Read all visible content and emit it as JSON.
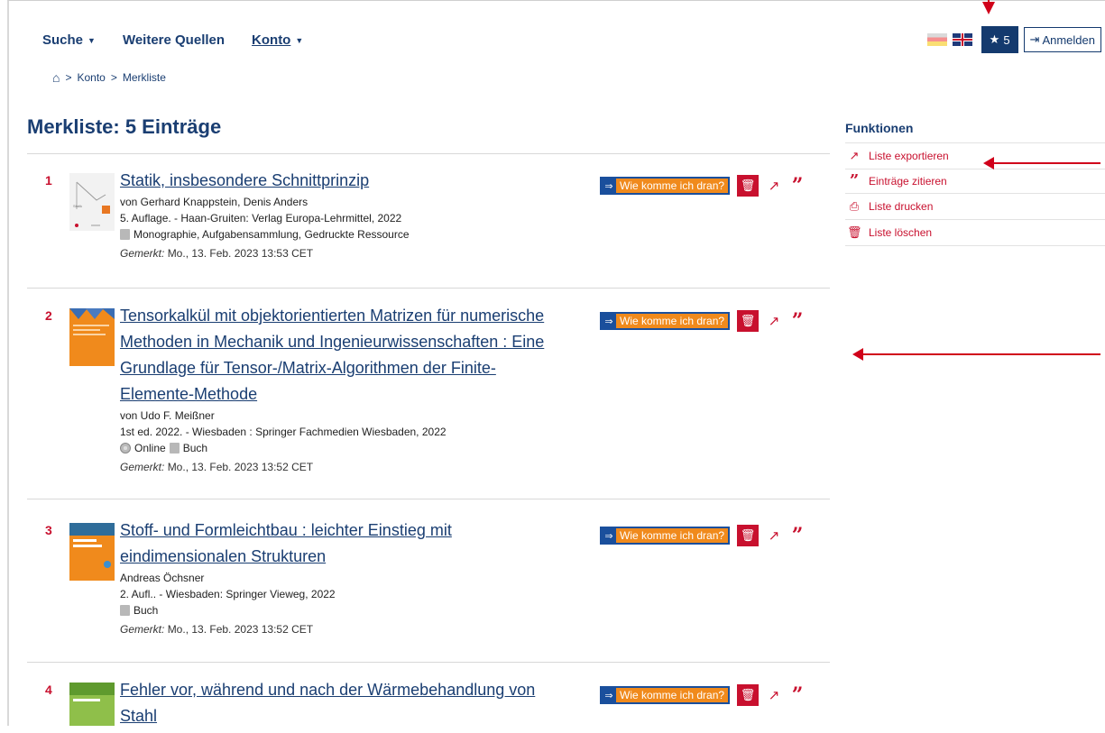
{
  "nav": {
    "items": [
      {
        "label": "Suche",
        "has_caret": true
      },
      {
        "label": "Weitere Quellen",
        "has_caret": false
      },
      {
        "label": "Konto",
        "has_caret": true
      }
    ]
  },
  "topright": {
    "bookmark_count": "5",
    "login_label": "Anmelden"
  },
  "breadcrumb": {
    "items": [
      "Konto",
      "Merkliste"
    ],
    "separator": ">"
  },
  "page_title": "Merkliste: 5 Einträge",
  "actions": {
    "wie_label": "Wie komme ich dran?"
  },
  "entries": [
    {
      "number": "1",
      "title_lines": [
        "Statik, insbesondere Schnittprinzip"
      ],
      "authors": "von Gerhard Knappstein, Denis Anders",
      "edition": "5. Auflage. - Haan-Gruiten: Verlag Europa-Lehrmittel, 2022",
      "media": [
        "Monographie, Aufgabensammlung, Gedruckte Ressource"
      ],
      "saved_prefix": "Gemerkt:",
      "saved_date": "Mo., 13. Feb. 2023 13:53 CET"
    },
    {
      "number": "2",
      "title_lines": [
        "Tensorkalkül mit objektorientierten Matrizen für numerische",
        "Methoden in Mechanik und Ingenieurwissenschaften : Eine",
        "Grundlage für Tensor-/Matrix-Algorithmen der Finite-",
        "Elemente-Methode"
      ],
      "authors": "von Udo F. Meißner",
      "edition": "1st ed. 2022. - Wiesbaden : Springer Fachmedien Wiesbaden, 2022",
      "media": [
        "Online",
        "Buch"
      ],
      "saved_prefix": "Gemerkt:",
      "saved_date": "Mo., 13. Feb. 2023 13:52 CET"
    },
    {
      "number": "3",
      "title_lines": [
        "Stoff- und Formleichtbau : leichter Einstieg mit",
        "eindimensionalen Strukturen"
      ],
      "authors": "Andreas Öchsner",
      "edition": "2. Aufl.. - Wiesbaden: Springer Vieweg, 2022",
      "media": [
        "Buch"
      ],
      "saved_prefix": "Gemerkt:",
      "saved_date": "Mo., 13. Feb. 2023 13:52 CET"
    },
    {
      "number": "4",
      "title_lines": [
        "Fehler vor, während und nach der Wärmebehandlung von",
        "Stahl"
      ],
      "authors": "",
      "edition": "",
      "media": [],
      "saved_prefix": "",
      "saved_date": ""
    }
  ],
  "sidebar": {
    "heading": "Funktionen",
    "items": [
      {
        "label": "Liste exportieren",
        "icon": "share-icon"
      },
      {
        "label": "Einträge zitieren",
        "icon": "quote-icon"
      },
      {
        "label": "Liste drucken",
        "icon": "print-icon"
      },
      {
        "label": "Liste löschen",
        "icon": "trash-icon"
      }
    ]
  },
  "colors": {
    "brand_blue": "#1a3e72",
    "accent_red": "#c8102e",
    "orange": "#f08a1c",
    "annotation_red": "#d0001a"
  }
}
